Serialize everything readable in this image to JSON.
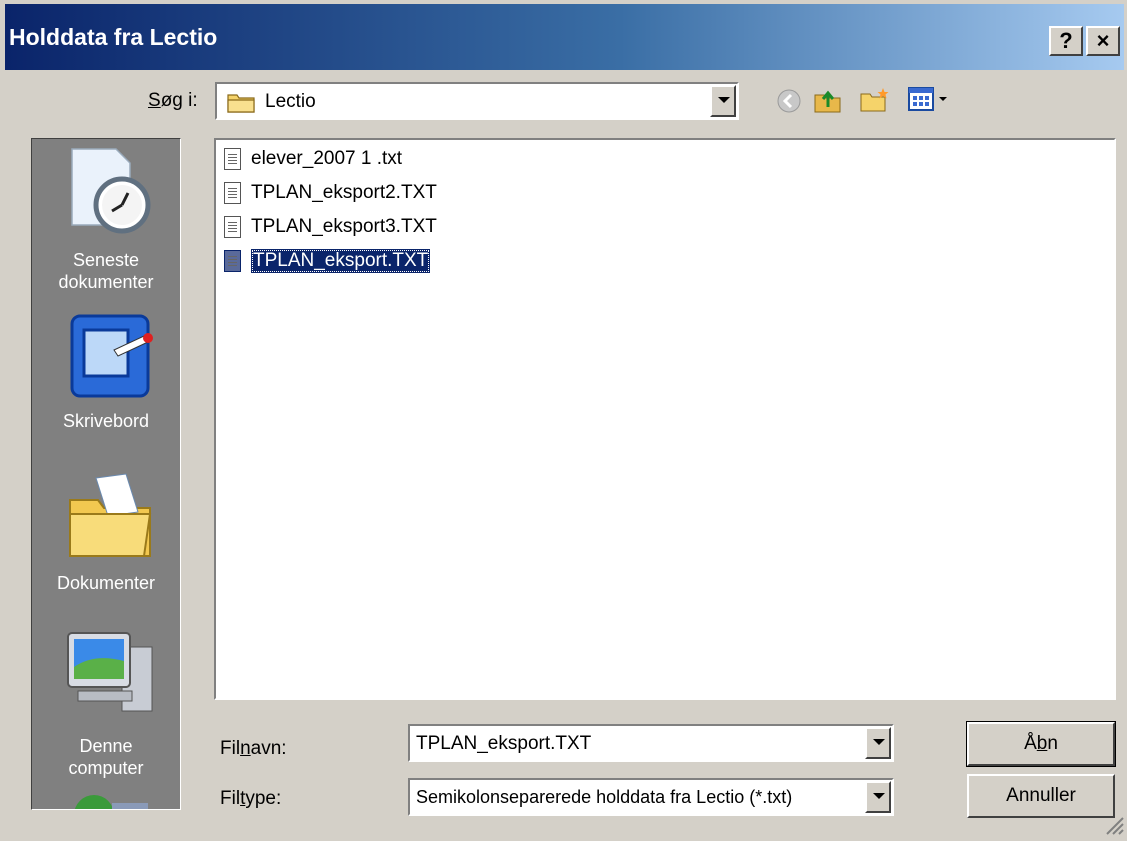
{
  "window": {
    "title": "Holddata fra Lectio",
    "help_label": "?",
    "close_label": "×"
  },
  "look_in": {
    "label_accel": "S",
    "label_rest": "øg i:",
    "value": "Lectio"
  },
  "toolbar": {
    "icons": [
      "back-icon",
      "up-folder-icon",
      "new-folder-icon",
      "view-menu-icon"
    ]
  },
  "places": [
    {
      "line1": "Seneste",
      "line2": "dokumenter",
      "icon": "recent-documents-icon"
    },
    {
      "line1": "Skrivebord",
      "line2": "",
      "icon": "desktop-icon"
    },
    {
      "line1": "Dokumenter",
      "line2": "",
      "icon": "documents-folder-icon"
    },
    {
      "line1": "Denne",
      "line2": "computer",
      "icon": "my-computer-icon"
    }
  ],
  "files": [
    {
      "name": "elever_2007 1 .txt",
      "selected": false
    },
    {
      "name": "TPLAN_eksport2.TXT",
      "selected": false
    },
    {
      "name": "TPLAN_eksport3.TXT",
      "selected": false
    },
    {
      "name": "TPLAN_eksport.TXT",
      "selected": true
    }
  ],
  "filename": {
    "label_a": "Fil",
    "label_accel": "n",
    "label_b": "avn:",
    "value": "TPLAN_eksport.TXT"
  },
  "filetype": {
    "label_a": "Fil",
    "label_accel": "t",
    "label_b": "ype:",
    "value": "Semikolonseparerede holddata fra Lectio (*.txt)"
  },
  "buttons": {
    "open_a": "Å",
    "open_accel": "b",
    "open_b": "n",
    "cancel": "Annuller"
  },
  "colors": {
    "title_start": "#0a246a",
    "title_end": "#a6caf0",
    "selection": "#0a246a",
    "face": "#d4d0c8"
  }
}
